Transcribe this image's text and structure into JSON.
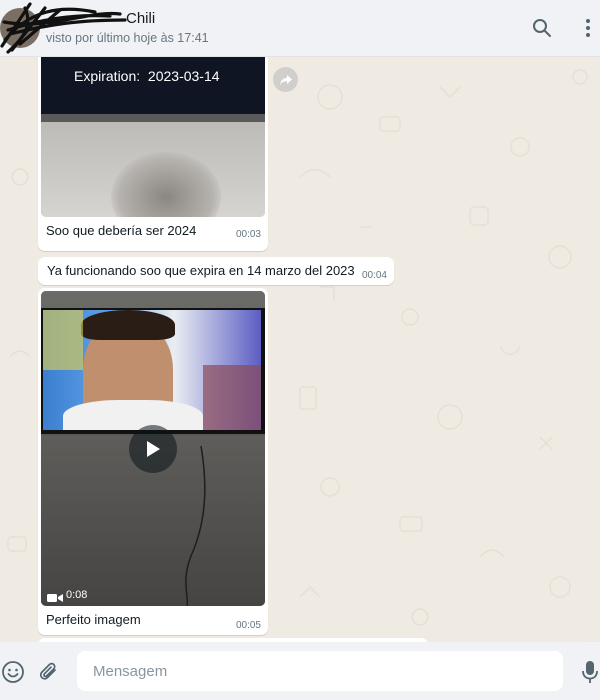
{
  "header": {
    "contact_name": "Chili",
    "status": "visto por último hoje às 17:41"
  },
  "messages": [
    {
      "type": "image",
      "overlay_text": "Expiration:  2023-03-14",
      "caption": "Soo que debería ser 2024",
      "time": "00:03"
    },
    {
      "type": "text",
      "text": "Ya funcionando soo que expira en 14 marzo del 2023",
      "time": "00:04"
    },
    {
      "type": "video",
      "duration": "0:08",
      "caption": "Perfeito imagem",
      "time": "00:05"
    }
  ],
  "composer": {
    "placeholder": "Mensagem"
  },
  "icons": {
    "search": "search-icon",
    "menu": "more-vertical-icon",
    "emoji": "emoji-icon",
    "attach": "paperclip-icon",
    "mic": "microphone-icon",
    "forward": "forward-icon",
    "play": "play-icon",
    "video": "video-camera-icon",
    "scroll": "chevron-down-icon"
  },
  "colors": {
    "header_bg": "#f0f2f5",
    "chat_bg": "#efeae2",
    "bubble_bg": "#ffffff",
    "text_primary": "#111b21",
    "text_secondary": "#667781"
  }
}
